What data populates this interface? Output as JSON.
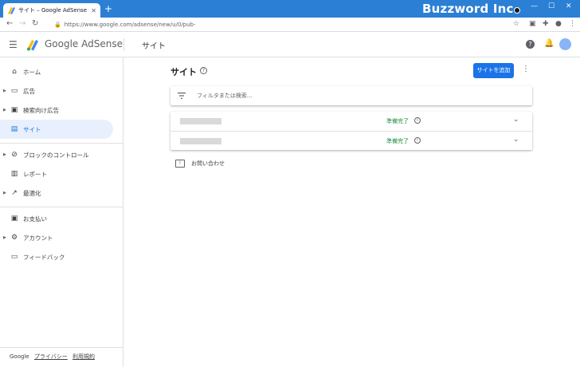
{
  "browser": {
    "tab_title": "サイト – Google AdSense",
    "url": "https://www.google.com/adsense/new/u/0/pub-",
    "brand_watermark": "Buzzword Inc."
  },
  "header": {
    "app_name": "Google AdSense",
    "page_heading": "サイト"
  },
  "sidebar": {
    "items": [
      {
        "label": "ホーム",
        "icon": "home-icon",
        "expandable": false
      },
      {
        "label": "広告",
        "icon": "ad-icon",
        "expandable": true
      },
      {
        "label": "検索向け広告",
        "icon": "search-ad-icon",
        "expandable": true
      },
      {
        "label": "サイト",
        "icon": "sites-icon",
        "expandable": false,
        "active": true
      },
      {
        "label": "ブロックのコントロール",
        "icon": "block-icon",
        "expandable": true
      },
      {
        "label": "レポート",
        "icon": "report-icon",
        "expandable": false
      },
      {
        "label": "最適化",
        "icon": "trending-icon",
        "expandable": true
      },
      {
        "label": "お支払い",
        "icon": "payment-icon",
        "expandable": false
      },
      {
        "label": "アカウント",
        "icon": "gear-icon",
        "expandable": true
      },
      {
        "label": "フィードバック",
        "icon": "feedback-icon",
        "expandable": false
      }
    ],
    "footer": {
      "brand": "Google",
      "privacy": "プライバシー",
      "terms": "利用規約"
    }
  },
  "main": {
    "title": "サイト",
    "add_button": "サイトを追加",
    "filter_placeholder": "フィルタまたは検索...",
    "sites": [
      {
        "status": "準備完了"
      },
      {
        "status": "準備完了"
      }
    ],
    "contact_label": "お問い合わせ"
  },
  "colors": {
    "accent": "#1a73e8",
    "status_ready": "#1e8e3e",
    "titlebar": "#2b7fd4"
  }
}
